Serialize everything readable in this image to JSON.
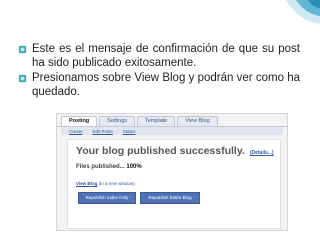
{
  "bullets": [
    "Este es el mensaje de confirmación de que su post ha sido publicado exitosamente.",
    "Presionamos sobre View Blog y podrán ver como ha quedado."
  ],
  "tabs": [
    {
      "label": "Posting",
      "active": true
    },
    {
      "label": "Settings",
      "active": false
    },
    {
      "label": "Template",
      "active": false
    },
    {
      "label": "View Blog",
      "active": false
    }
  ],
  "subtabs": [
    "Create",
    "Edit Posts",
    "Status"
  ],
  "panel": {
    "headline": "Your blog published successfully.",
    "details_link": "(Details...)",
    "files_label": "Files published...",
    "files_pct": "100%",
    "view_link": "View Blog",
    "view_new_window": "(in a new window)",
    "button_index": "Republish Index Only",
    "button_entire": "Republish Entire Blog"
  },
  "colors": {
    "accent": "#5072b5",
    "bullet": "#39a8b8",
    "corner": "#2a8fb3"
  }
}
